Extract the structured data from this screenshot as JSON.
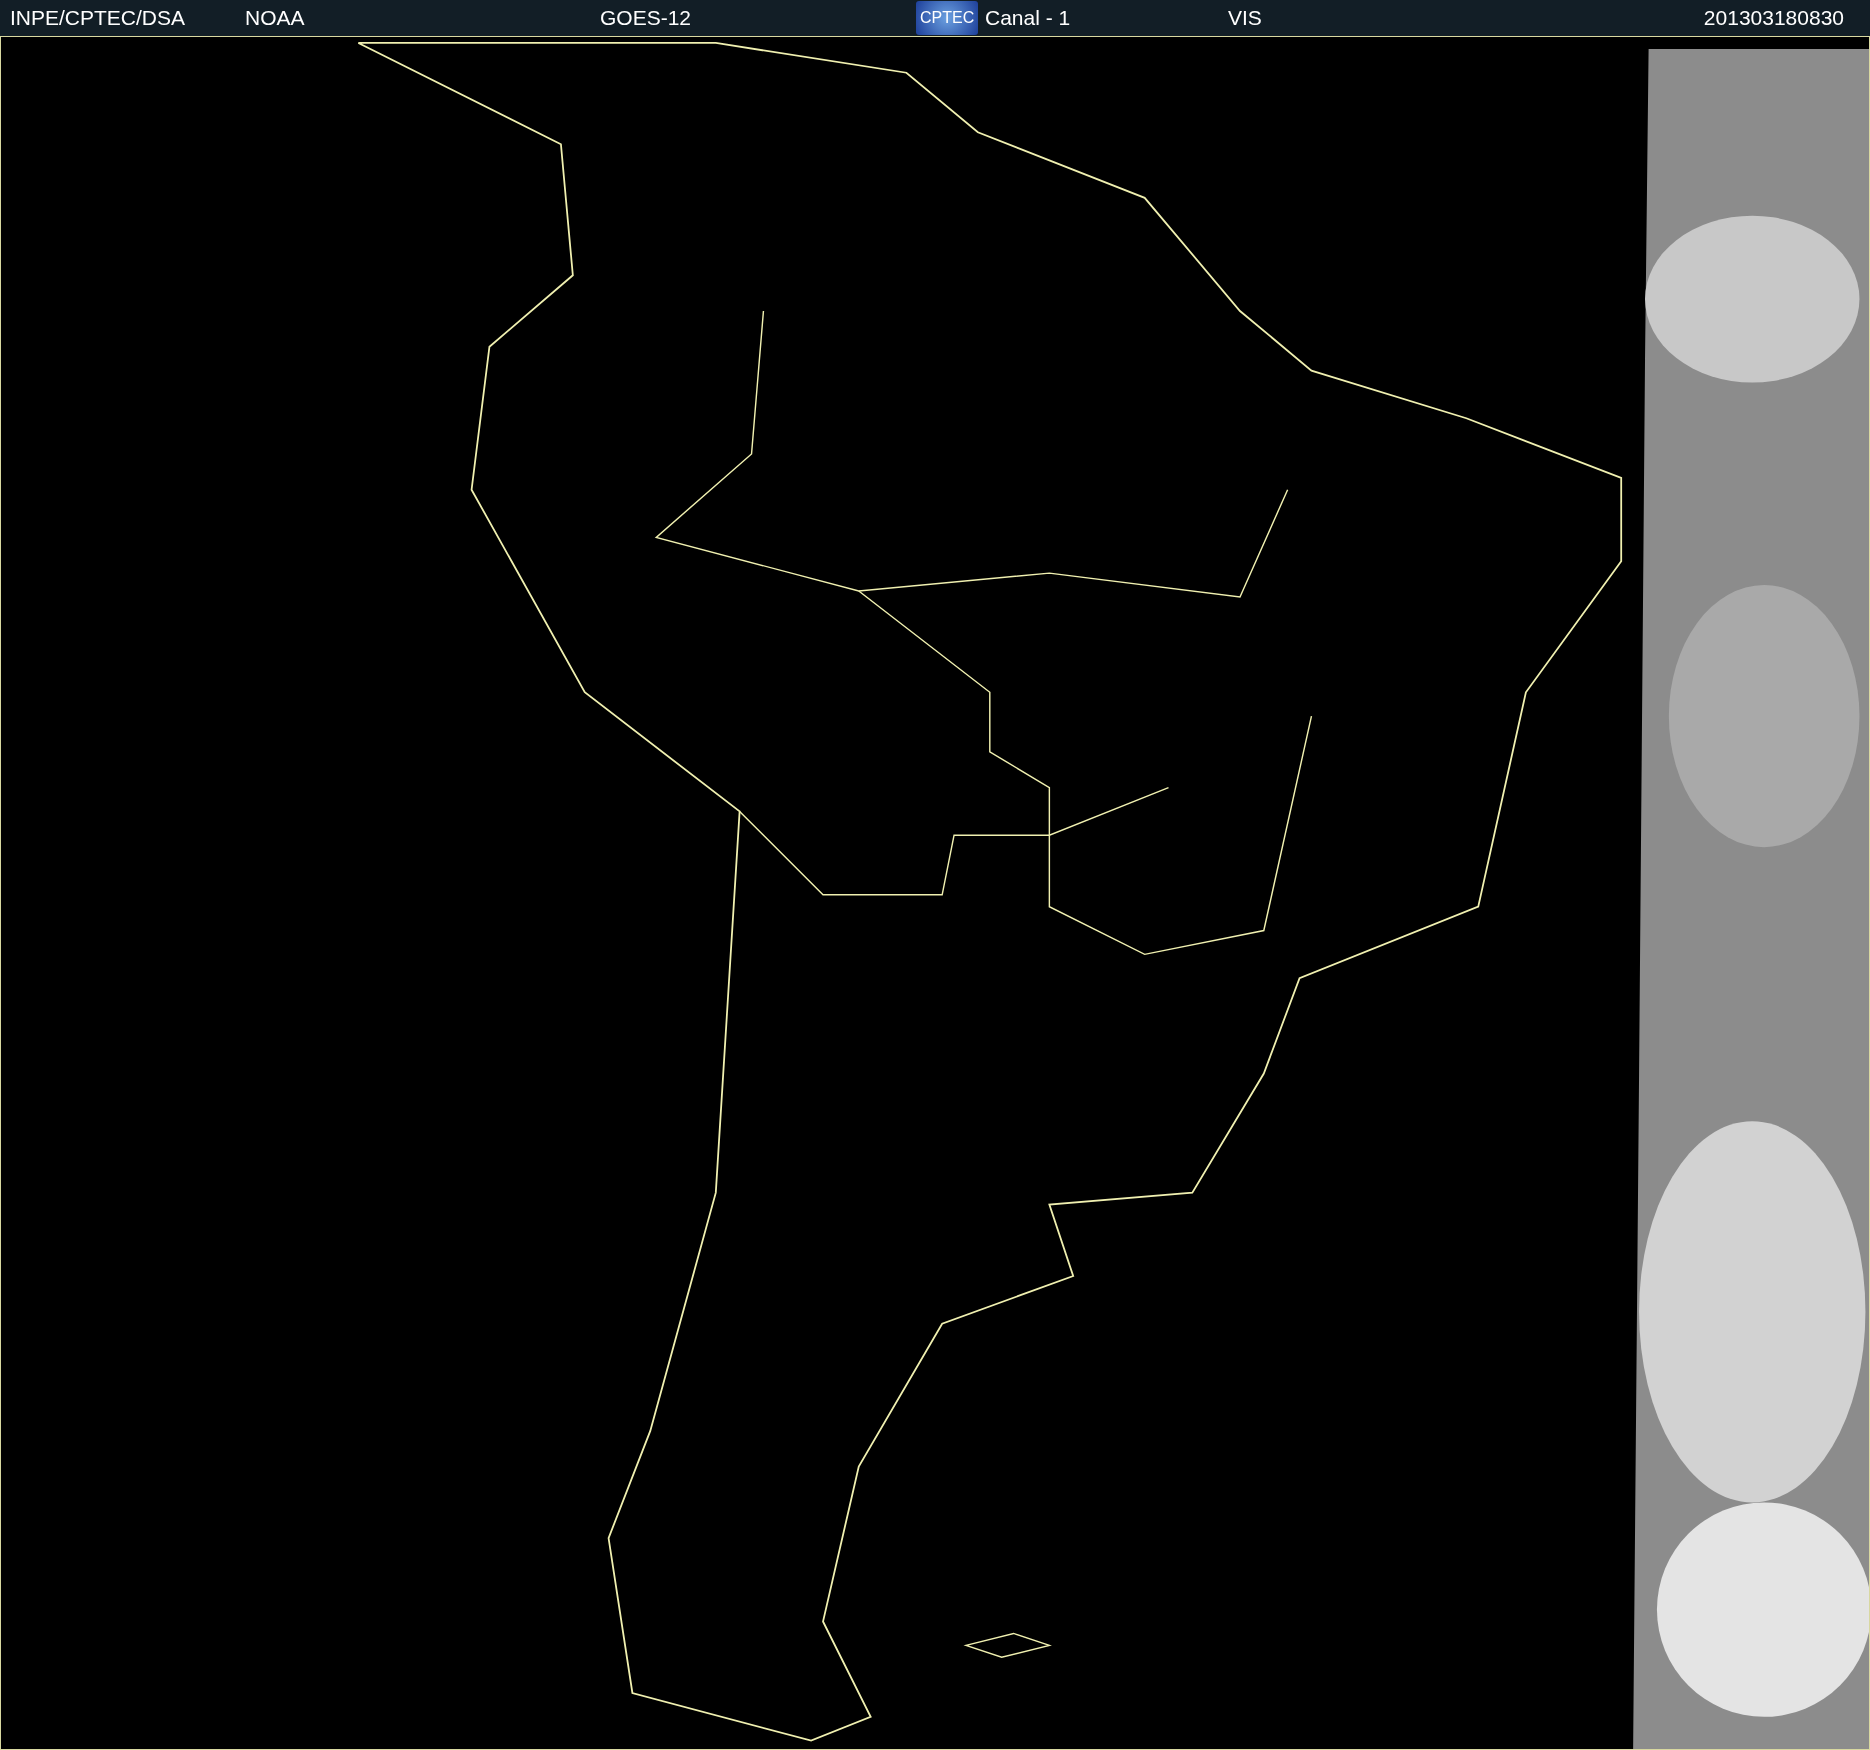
{
  "header": {
    "items": [
      {
        "kind": "text",
        "text": "INPE/CPTEC/DSA"
      },
      {
        "kind": "text",
        "text": "NOAA"
      },
      {
        "kind": "text",
        "text": "GOES-12"
      },
      {
        "kind": "logo",
        "text": "CPTEC"
      },
      {
        "kind": "text",
        "text": "Canal - 1"
      },
      {
        "kind": "text",
        "text": "VIS"
      },
      {
        "kind": "text",
        "text": "201303180830"
      }
    ]
  }
}
